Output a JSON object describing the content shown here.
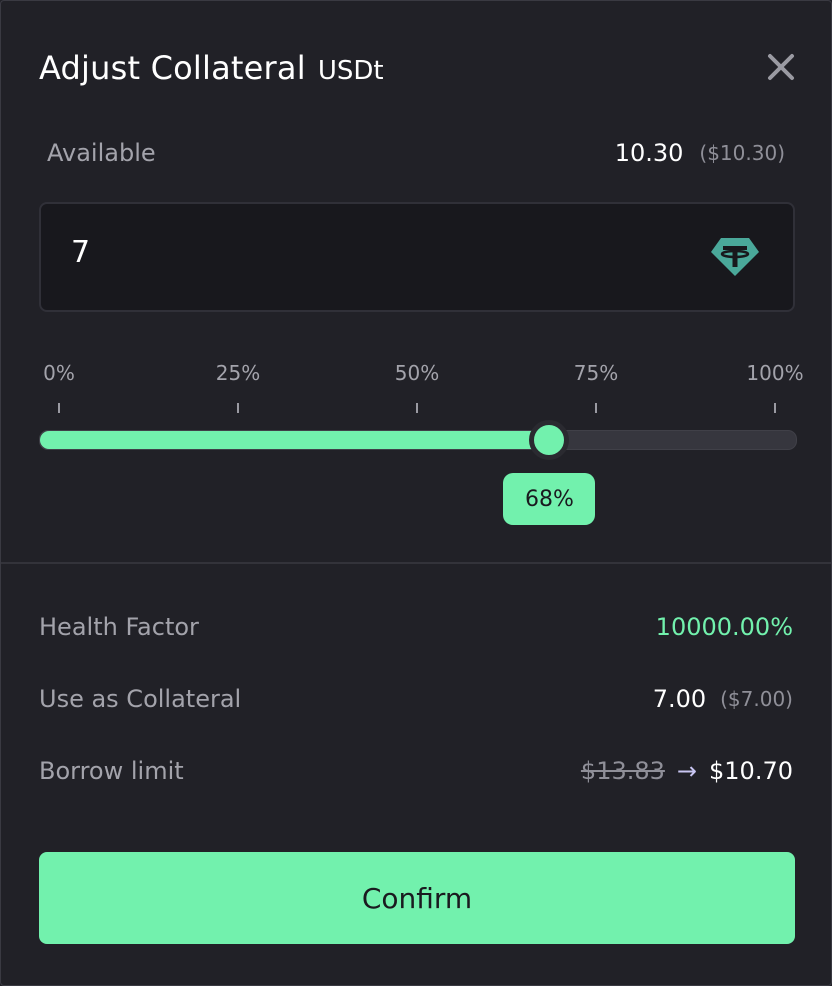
{
  "modal": {
    "title": "Adjust Collateral",
    "token": "USDt",
    "close_icon": "close-icon"
  },
  "available": {
    "label": "Available",
    "amount": "10.30",
    "usd": "($10.30)"
  },
  "input": {
    "value": "7",
    "token_icon": "tether-icon",
    "token_icon_color": "#4aa89a"
  },
  "slider": {
    "ticks": [
      "0%",
      "25%",
      "50%",
      "75%",
      "100%"
    ],
    "value": 0.68,
    "value_label": "68%",
    "accent": "#72f1ad"
  },
  "details": {
    "health_factor": {
      "label": "Health Factor",
      "value": "10000.00%",
      "color": "#72f1ad"
    },
    "use_as_collateral": {
      "label": "Use as Collateral",
      "amount": "7.00",
      "usd": "($7.00)"
    },
    "borrow_limit": {
      "label": "Borrow limit",
      "old": "$13.83",
      "arrow": "→",
      "new": "$10.70"
    }
  },
  "confirm": {
    "label": "Confirm"
  }
}
